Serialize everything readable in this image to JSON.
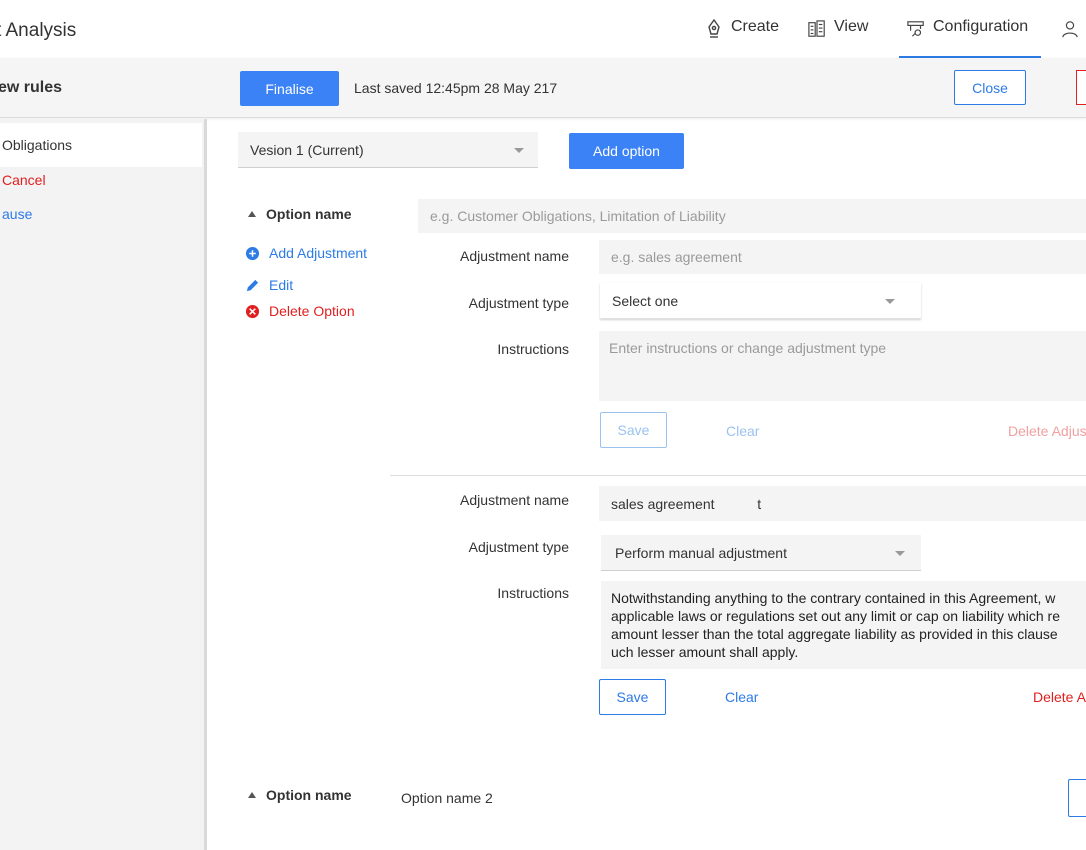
{
  "header": {
    "app_title": "t Analysis",
    "nav": [
      {
        "label": "Create",
        "icon": "pen-nib-icon"
      },
      {
        "label": "View",
        "icon": "buildings-icon"
      },
      {
        "label": "Configuration",
        "icon": "configuration-icon",
        "active": true
      }
    ],
    "user_icon": "user-icon"
  },
  "subheader": {
    "title": "ew rules",
    "finalise_label": "Finalise",
    "last_saved": "Last saved 12:45pm 28 May 217",
    "close_label": "Close"
  },
  "sidebar": {
    "active_item": "Obligations",
    "cancel_link": "Cancel",
    "clause_link": "ause"
  },
  "version": {
    "selected": "Vesion 1 (Current)",
    "add_option_label": "Add option"
  },
  "option1": {
    "heading": "Option name",
    "name_placeholder": "e.g. Customer Obligations, Limitation of Liability",
    "actions": {
      "add_adjustment": "Add Adjustment",
      "edit": "Edit",
      "delete_option": "Delete Option"
    },
    "adjustment_new": {
      "name_label": "Adjustment name",
      "name_placeholder": "e.g. sales agreement",
      "type_label": "Adjustment type",
      "type_selected": "Select one",
      "instructions_label": "Instructions",
      "instructions_placeholder": "Enter instructions or change adjustment type",
      "save_label": "Save",
      "clear_label": "Clear",
      "delete_label": "Delete Adjus"
    },
    "adjustment_existing": {
      "name_label": "Adjustment name",
      "name_value": "sales agreement           t",
      "type_label": "Adjustment type",
      "type_selected": "Perform manual adjustment",
      "instructions_label": "Instructions",
      "instructions_value": "Notwithstanding anything to the contrary contained in this Agreement, w\napplicable laws or regulations set out any limit or cap on liability which re\namount lesser than the total aggregate liability as provided in this clause\nuch lesser amount shall apply.",
      "save_label": "Save",
      "clear_label": "Clear",
      "delete_label": "Delete A"
    }
  },
  "option2": {
    "heading": "Option name",
    "name_value": "Option name 2"
  }
}
